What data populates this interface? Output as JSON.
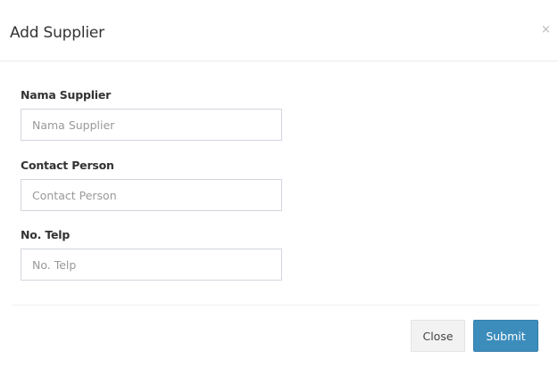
{
  "modal": {
    "title": "Add Supplier",
    "close_icon": "×"
  },
  "form": {
    "fields": [
      {
        "label": "Nama Supplier",
        "placeholder": "Nama Supplier",
        "value": ""
      },
      {
        "label": "Contact Person",
        "placeholder": "Contact Person",
        "value": ""
      },
      {
        "label": "No. Telp",
        "placeholder": "No. Telp",
        "value": ""
      }
    ]
  },
  "footer": {
    "close_label": "Close",
    "submit_label": "Submit"
  },
  "colors": {
    "primary": "#3c8dbc",
    "default_button": "#f2f2f2",
    "input_border": "#d2d6de"
  }
}
